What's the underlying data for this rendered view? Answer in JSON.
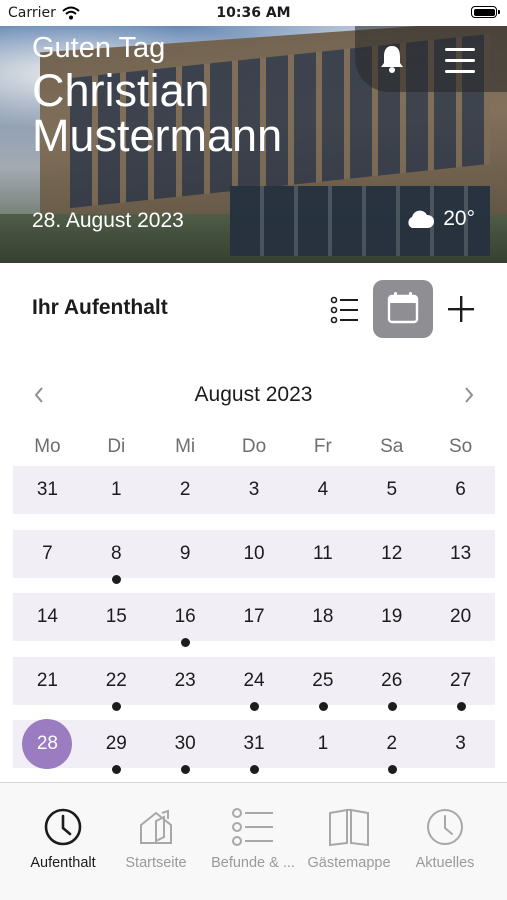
{
  "status_bar": {
    "carrier": "Carrier",
    "time": "10:36 AM"
  },
  "hero": {
    "greeting": "Guten Tag",
    "user_name": "Christian Mustermann",
    "date": "28. August 2023",
    "temperature": "20°",
    "weather_icon": "cloud-icon"
  },
  "section": {
    "title": "Ihr Aufenthalt"
  },
  "calendar": {
    "month_label": "August 2023",
    "weekdays": [
      "Mo",
      "Di",
      "Mi",
      "Do",
      "Fr",
      "Sa",
      "So"
    ],
    "weeks": [
      [
        {
          "d": "31"
        },
        {
          "d": "1"
        },
        {
          "d": "2"
        },
        {
          "d": "3"
        },
        {
          "d": "4"
        },
        {
          "d": "5"
        },
        {
          "d": "6"
        }
      ],
      [
        {
          "d": "7"
        },
        {
          "d": "8",
          "dot": true
        },
        {
          "d": "9"
        },
        {
          "d": "10"
        },
        {
          "d": "11"
        },
        {
          "d": "12"
        },
        {
          "d": "13"
        }
      ],
      [
        {
          "d": "14"
        },
        {
          "d": "15"
        },
        {
          "d": "16",
          "dot": true
        },
        {
          "d": "17"
        },
        {
          "d": "18"
        },
        {
          "d": "19"
        },
        {
          "d": "20"
        }
      ],
      [
        {
          "d": "21"
        },
        {
          "d": "22",
          "dot": true
        },
        {
          "d": "23"
        },
        {
          "d": "24",
          "dot": true
        },
        {
          "d": "25",
          "dot": true
        },
        {
          "d": "26",
          "dot": true
        },
        {
          "d": "27",
          "dot": true
        }
      ],
      [
        {
          "d": "28",
          "today": true
        },
        {
          "d": "29",
          "dot": true
        },
        {
          "d": "30",
          "dot": true
        },
        {
          "d": "31",
          "dot": true
        },
        {
          "d": "1"
        },
        {
          "d": "2",
          "dot": true
        },
        {
          "d": "3"
        }
      ]
    ],
    "today_color": "#9b7cc0"
  },
  "tab_bar": {
    "tabs": [
      {
        "label": "Aufenthalt",
        "icon": "clock-icon",
        "active": true
      },
      {
        "label": "Startseite",
        "icon": "house-icon",
        "active": false
      },
      {
        "label": "Befunde & ...",
        "icon": "list-icon",
        "active": false
      },
      {
        "label": "Gästemappe",
        "icon": "book-icon",
        "active": false
      },
      {
        "label": "Aktuelles",
        "icon": "clock-icon",
        "active": false
      }
    ]
  }
}
